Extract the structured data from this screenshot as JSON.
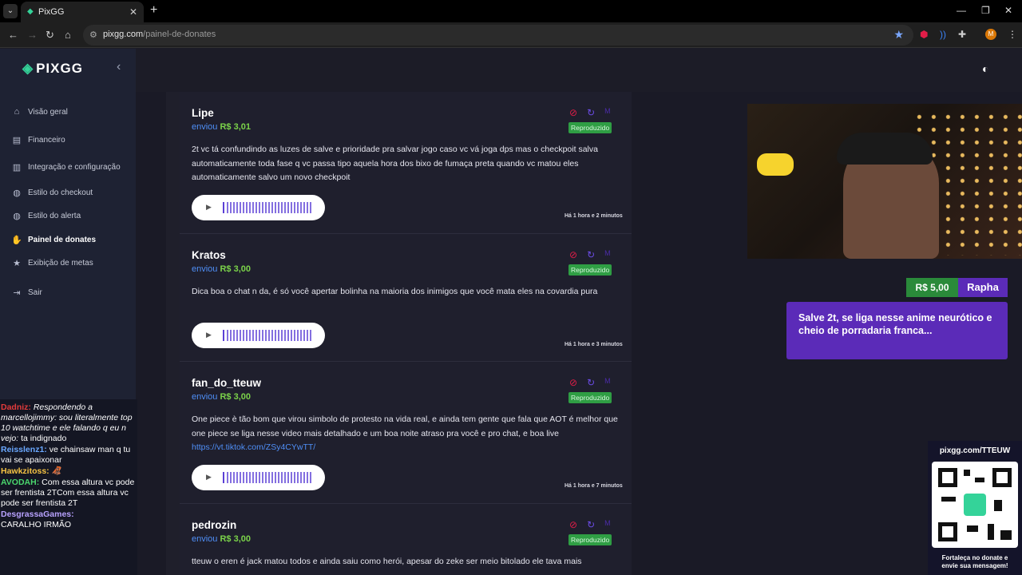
{
  "browser": {
    "tab_title": "PixGG",
    "url_host": "pixgg.com",
    "url_path": "/painel-de-donates",
    "profile_initial": "M"
  },
  "app": {
    "logo_text": "PIXGG",
    "nav": [
      {
        "label": "Visão geral",
        "icon": "home-icon"
      },
      {
        "label": "Financeiro",
        "icon": "finance-icon"
      },
      {
        "label": "Integração e configuração",
        "icon": "integration-icon"
      },
      {
        "label": "Estilo do checkout",
        "icon": "palette-icon"
      },
      {
        "label": "Estilo do alerta",
        "icon": "palette-icon"
      },
      {
        "label": "Painel de donates",
        "icon": "donate-icon"
      },
      {
        "label": "Exibição de metas",
        "icon": "star-icon"
      },
      {
        "label": "Sair",
        "icon": "logout-icon"
      }
    ]
  },
  "donations": [
    {
      "name": "Lipe",
      "sent": "enviou",
      "amount": "R$ 3,01",
      "status": "Reproduzido",
      "message": "2t vc tá confundindo as luzes de salve e prioridade pra salvar jogo caso vc vá joga dps mas o checkpoit salva automaticamente toda fase q vc passa tipo aquela hora dos bixo de fumaça preta quando vc matou eles automaticamente salvo um novo checkpoit",
      "time": "Há 1 hora e 2 minutos"
    },
    {
      "name": "Kratos",
      "sent": "enviou",
      "amount": "R$ 3,00",
      "status": "Reproduzido",
      "message": "Dica boa o chat n da, é só você apertar bolinha na maioria dos inimigos que você mata eles na covardia pura",
      "time": "Há 1 hora e 3 minutos"
    },
    {
      "name": "fan_do_tteuw",
      "sent": "enviou",
      "amount": "R$ 3,00",
      "status": "Reproduzido",
      "message": "One piece è tão bom que virou simbolo de protesto na vida real, e ainda tem gente que fala que AOT é melhor que one piece se liga nesse video mais detalhado e um boa noite atraso pra você e pro chat, e boa live",
      "link": "https://vt.tiktok.com/ZSy4CYwTT/",
      "time": "Há 1 hora e 7 minutos"
    },
    {
      "name": "pedrozin",
      "sent": "enviou",
      "amount": "R$ 3,00",
      "status": "Reproduzido",
      "message": "tteuw o eren é jack matou todos e ainda saiu como herói, apesar do zeke ser meio bitolado ele tava mais"
    }
  ],
  "chat": [
    {
      "nick": "Dadniz:",
      "color": "#e23b3b",
      "reply": "Respondendo a marcellojimmy: sou literalmente top 10 watchtime e ele falando q eu n vejo:",
      "text": "ta indignado"
    },
    {
      "nick": "Reisslenz1:",
      "color": "#6aa8ff",
      "text": "ve chainsaw man q tu vai se apaixonar"
    },
    {
      "nick": "Hawkzitoss:",
      "color": "#f6c343",
      "text": "🦧"
    },
    {
      "nick": "AVODAH:",
      "color": "#4ad66d",
      "text": "Com essa altura vc pode ser frentista 2TCom essa altura vc pode ser frentista 2T"
    },
    {
      "nick": "DesgrassaGames:",
      "color": "#b8a2ff",
      "text": "CARALHO IRMÃO"
    }
  ],
  "alert": {
    "amount": "R$ 5,00",
    "name": "Rapha",
    "message": "Salve 2t, se liga nesse anime neurótico e cheio de porradaria franca..."
  },
  "qr": {
    "url": "pixgg.com/TTEUW",
    "caption_line1": "Fortaleça no donate e",
    "caption_line2": "envie sua mensagem!"
  },
  "colors": {
    "accent_green": "#34d399",
    "amount_green": "#7bd34a",
    "link_blue": "#4f8ff7",
    "alert_purple": "#5b2bb8",
    "badge_green": "#2f9e44"
  }
}
